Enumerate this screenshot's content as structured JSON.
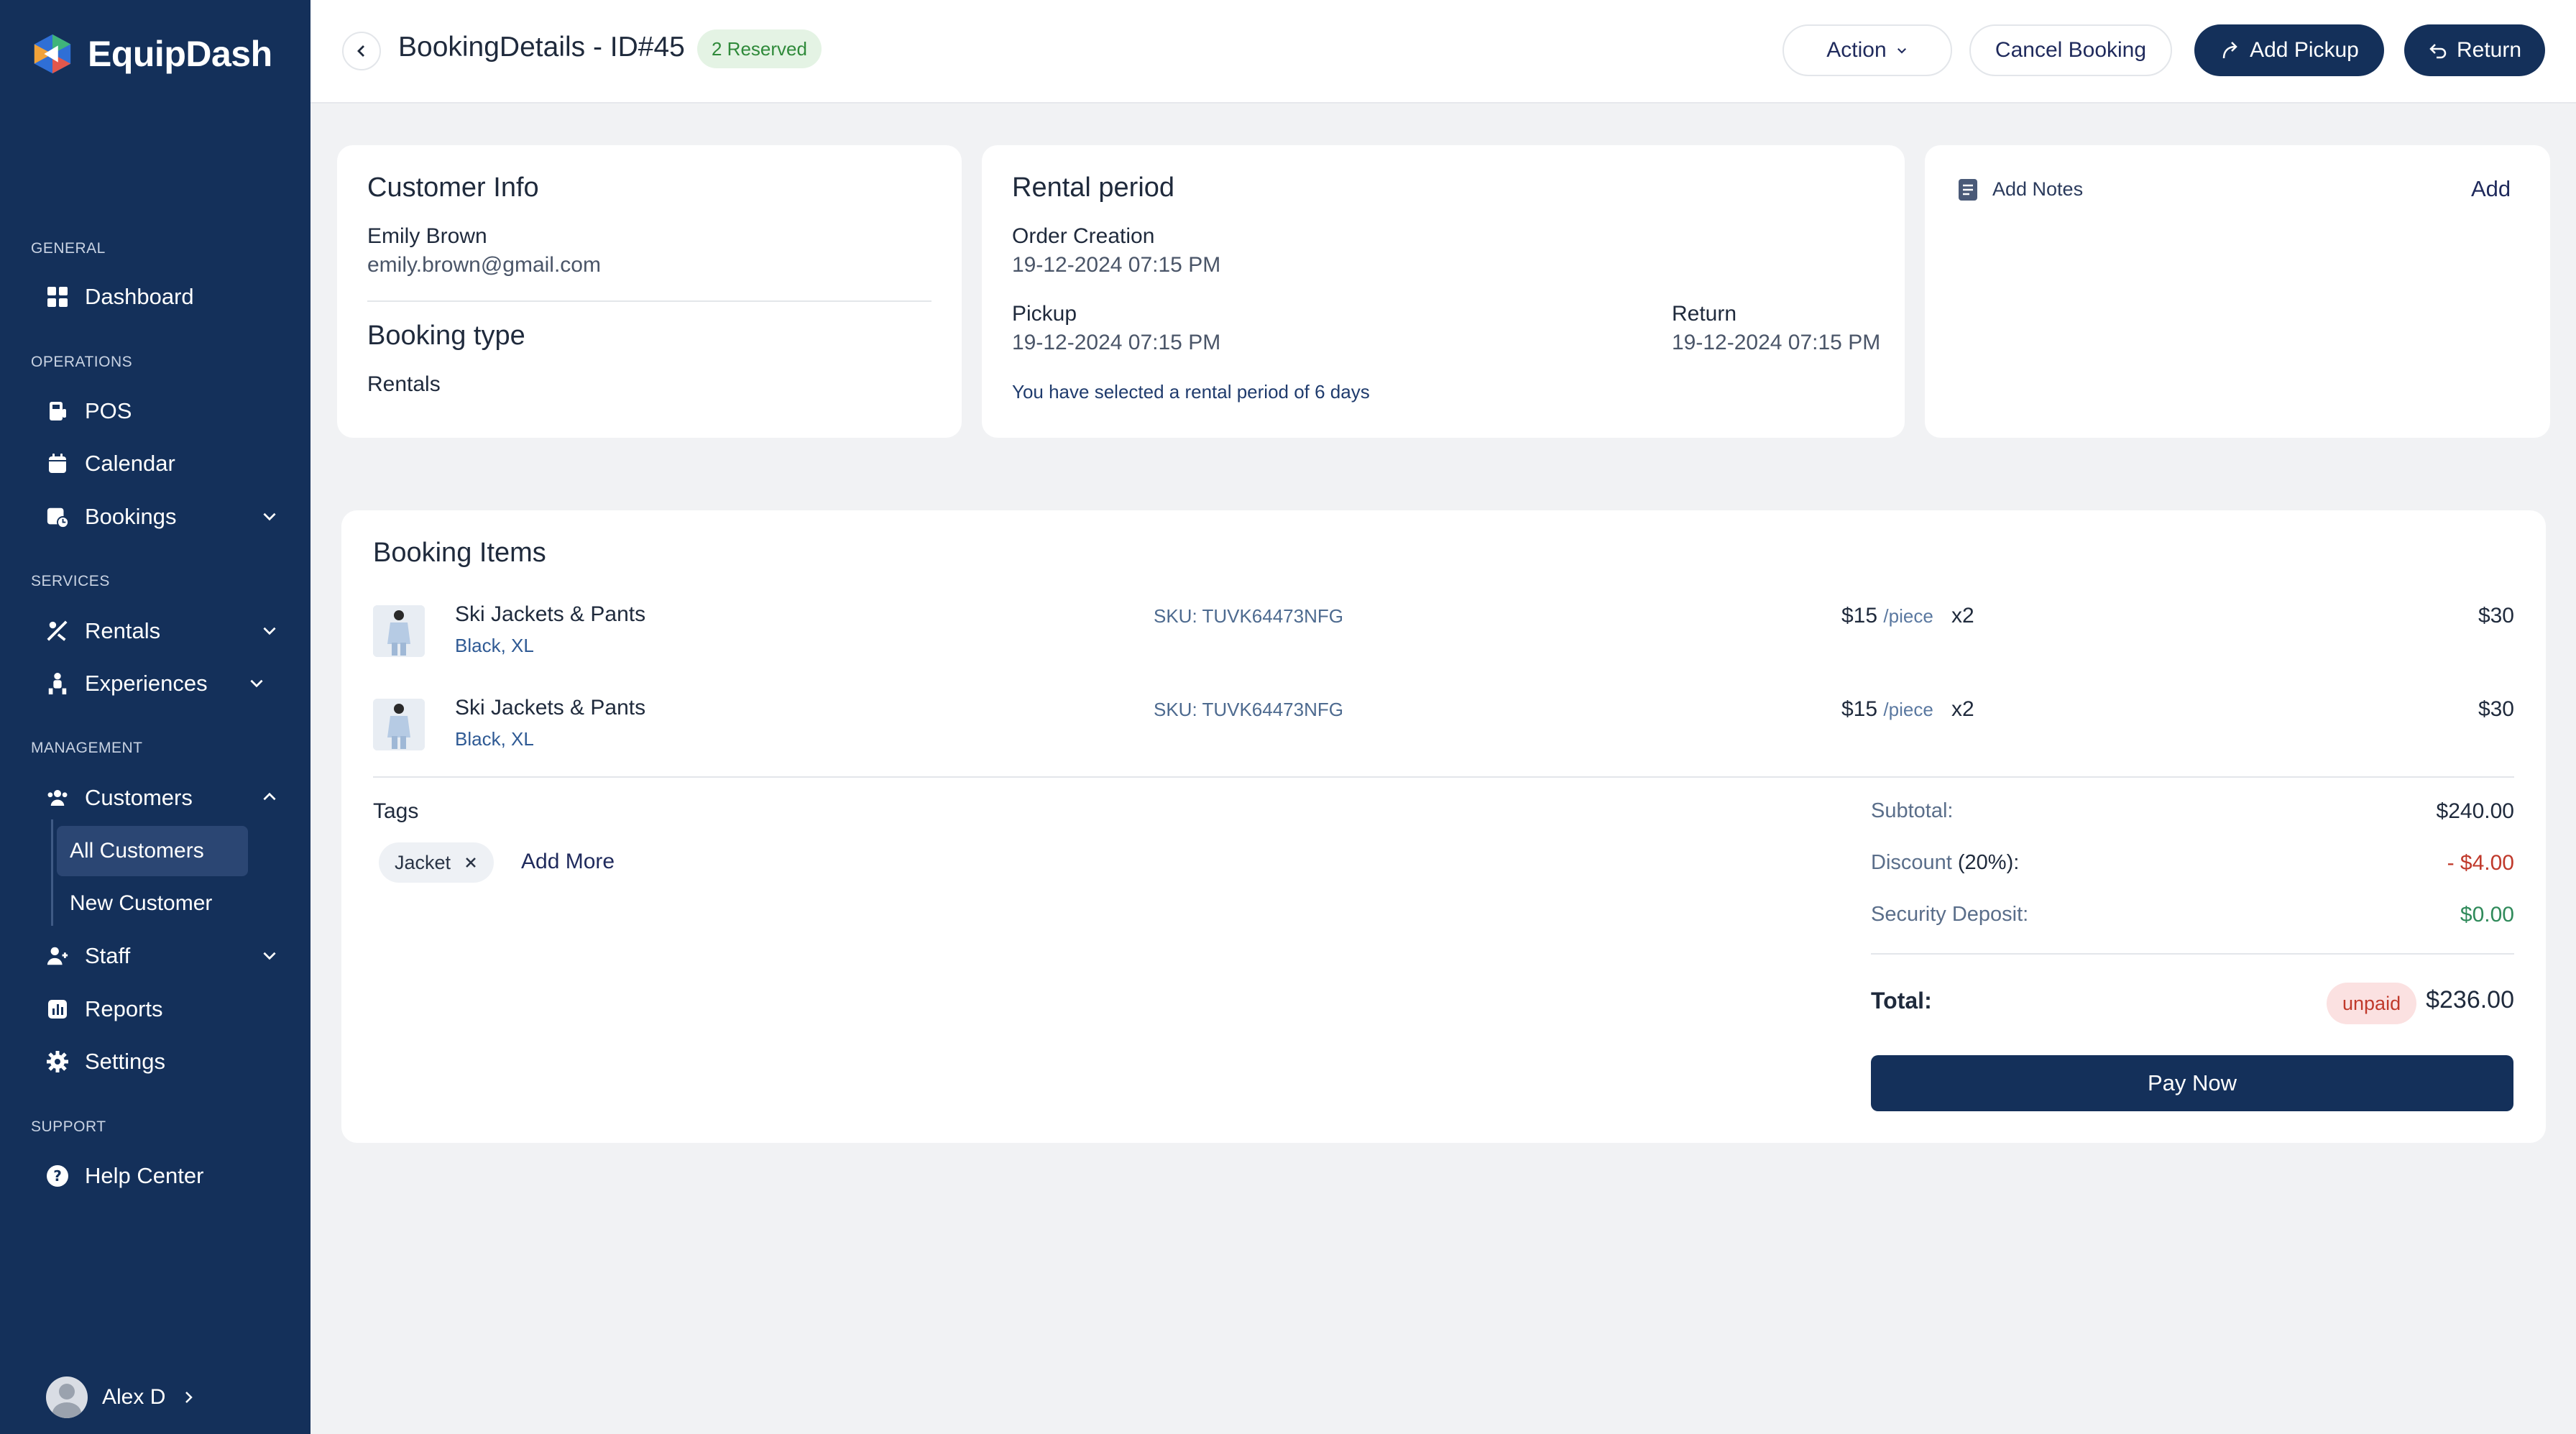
{
  "app": {
    "name": "EquipDash"
  },
  "sidebar": {
    "sections": {
      "general": "GENERAL",
      "operations": "OPERATIONS",
      "services": "SERVICES",
      "management": "MANAGEMENT",
      "support": "SUPPORT"
    },
    "items": {
      "dashboard": "Dashboard",
      "pos": "POS",
      "calendar": "Calendar",
      "bookings": "Bookings",
      "rentals": "Rentals",
      "experiences": "Experiences",
      "customers": "Customers",
      "all_customers": "All Customers",
      "new_customer": "New Customer",
      "staff": "Staff",
      "reports": "Reports",
      "settings": "Settings",
      "help_center": "Help Center"
    },
    "user": {
      "name": "Alex D"
    }
  },
  "header": {
    "title": "BookingDetails - ID#45",
    "status": "2 Reserved",
    "action_label": "Action",
    "cancel_label": "Cancel Booking",
    "pickup_label": "Add Pickup",
    "return_label": "Return"
  },
  "customer_info": {
    "title": "Customer Info",
    "name": "Emily Brown",
    "email": "emily.brown@gmail.com",
    "booking_type_title": "Booking type",
    "booking_type": "Rentals"
  },
  "rental_period": {
    "title": "Rental period",
    "order_creation_label": "Order Creation",
    "order_creation_value": "19-12-2024 07:15 PM",
    "pickup_label": "Pickup",
    "pickup_value": "19-12-2024 07:15 PM",
    "return_label": "Return",
    "return_value": "19-12-2024 07:15 PM",
    "note": "You have selected a rental period of 6 days"
  },
  "notes": {
    "title": "Add Notes",
    "add_label": "Add"
  },
  "booking_items": {
    "title": "Booking Items",
    "items": [
      {
        "name": "Ski Jackets & Pants",
        "variant": "Black, XL",
        "sku": "SKU: TUVK64473NFG",
        "price": "$15",
        "unit": "/piece",
        "qty": "x2",
        "total": "$30"
      },
      {
        "name": "Ski Jackets & Pants",
        "variant": "Black, XL",
        "sku": "SKU: TUVK64473NFG",
        "price": "$15",
        "unit": "/piece",
        "qty": "x2",
        "total": "$30"
      }
    ]
  },
  "tags": {
    "title": "Tags",
    "chips": [
      "Jacket"
    ],
    "add_more": "Add More"
  },
  "summary": {
    "subtotal_label": "Subtotal:",
    "subtotal": "$240.00",
    "discount_label": "Discount",
    "discount_pct": "(20%):",
    "discount": "- $4.00",
    "deposit_label": "Security Deposit:",
    "deposit": "$0.00",
    "total_label": "Total:",
    "payment_status": "unpaid",
    "total": "$236.00",
    "pay_label": "Pay Now"
  },
  "colors": {
    "sidebar_bg": "#14305a",
    "accent": "#14305a",
    "success": "#2f8a3a",
    "danger": "#c0392b",
    "page_bg": "#f1f2f4"
  }
}
